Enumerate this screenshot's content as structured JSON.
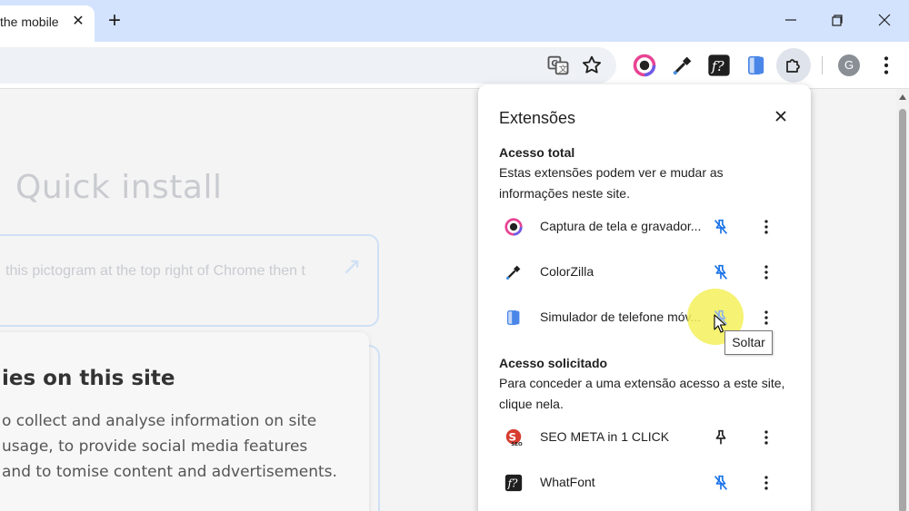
{
  "browser": {
    "tab_title": "the mobile",
    "tab_close_icon": "close-icon",
    "new_tab_label": "+",
    "window_controls": [
      "minimize-icon",
      "restore-icon",
      "close-icon"
    ],
    "avatar_letter": "G"
  },
  "page": {
    "quick_install_title": "Quick install",
    "quick_install_text": "this pictogram at the top right of Chrome then t",
    "cookie_title": "ies on this site",
    "cookie_body": "o collect and analyse information on site usage, to provide social media features and to tomise content and advertisements."
  },
  "popup": {
    "title": "Extensões",
    "full_access": {
      "heading": "Acesso total",
      "description": "Estas extensões podem ver e mudar as informações neste site.",
      "items": [
        {
          "name": "Captura de tela e gravador...",
          "icon": "screen-capture-icon",
          "pinned": true
        },
        {
          "name": "ColorZilla",
          "icon": "eyedropper-icon",
          "pinned": true
        },
        {
          "name": "Simulador de telefone móv...",
          "icon": "phone-simulator-icon",
          "pinned": true
        }
      ]
    },
    "requested_access": {
      "heading": "Acesso solicitado",
      "description": "Para conceder a uma extensão acesso a este site, clique nela.",
      "items": [
        {
          "name": "SEO META in 1 CLICK",
          "icon": "seo-meta-icon",
          "pinned": false
        },
        {
          "name": "WhatFont",
          "icon": "whatfont-icon",
          "pinned": true
        }
      ]
    },
    "tooltip": "Soltar"
  },
  "colors": {
    "tabstrip": "#d3e3fd",
    "pin_blue": "#1a73e8",
    "highlight": "#f5f05a"
  }
}
